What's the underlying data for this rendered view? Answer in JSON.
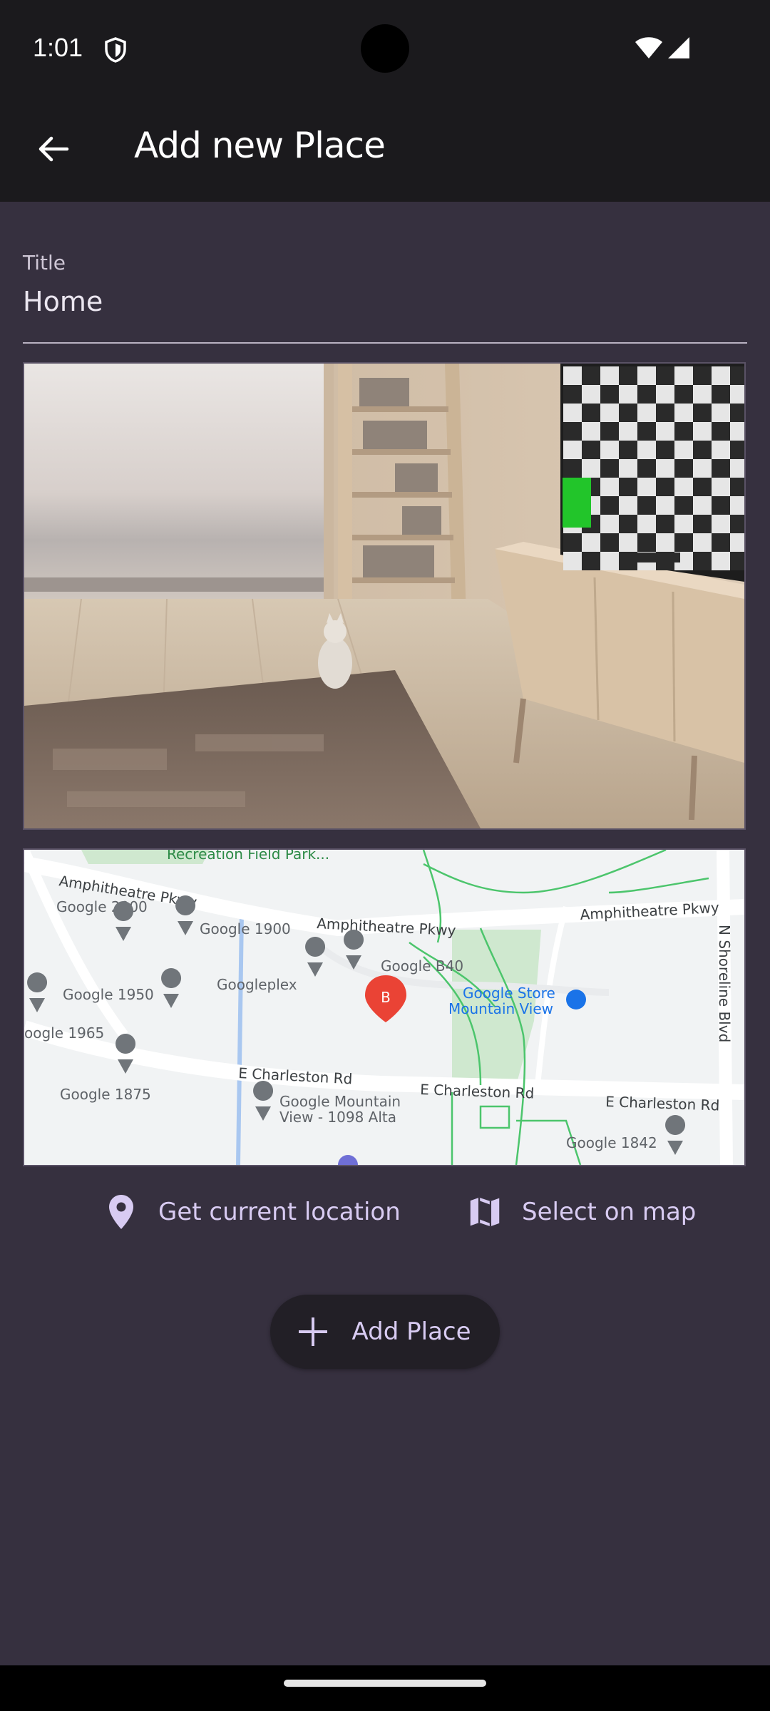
{
  "status": {
    "time": "1:01"
  },
  "appbar": {
    "title": "Add new Place"
  },
  "form": {
    "title_label": "Title",
    "title_value": "Home"
  },
  "map": {
    "labels": {
      "recreation": "Recreation Field Park...",
      "amphitheatre_left": "Amphitheatre Pkwy",
      "amphitheatre_mid": "Amphitheatre Pkwy",
      "amphitheatre_right": "Amphitheatre Pkwy",
      "google2000": "Google 2000",
      "google1900": "Google 1900",
      "googleb40": "Google B40",
      "google1950": "Google 1950",
      "googleplex": "Googleplex",
      "google_store_1": "Google Store",
      "google_store_2": "Mountain View",
      "google1965": "oogle 1965",
      "google1875": "Google 1875",
      "charleston_left": "E Charleston Rd",
      "charleston_mid": "E Charleston Rd",
      "charleston_right": "E Charleston Rd",
      "google_mv_1": "Google Mountain",
      "google_mv_2": "View - 1098 Alta",
      "google1842": "Google 1842",
      "shoreline": "N Shoreline Blvd",
      "marker": "B"
    }
  },
  "actions": {
    "current_location": "Get current location",
    "select_on_map": "Select on map"
  },
  "add_button": {
    "label": "Add Place"
  },
  "colors": {
    "accent": "#d8cbf2",
    "background": "#36303f",
    "appbar": "#1b1a1d"
  }
}
